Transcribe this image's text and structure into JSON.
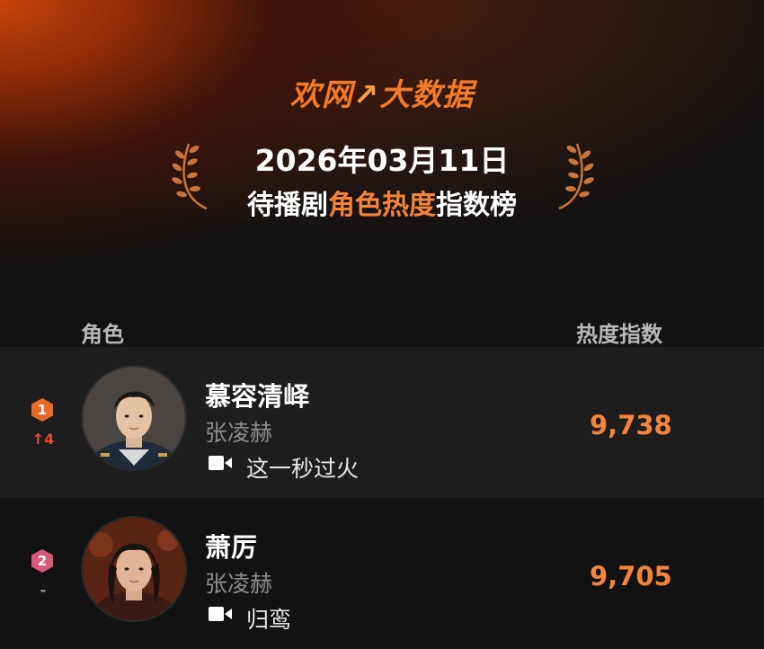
{
  "header": {
    "brand_part1": "欢网",
    "brand_slash": "↗",
    "brand_part2": "大数据",
    "date": "2026年03月11日",
    "title_prefix": "待播剧",
    "title_highlight": "角色热度",
    "title_suffix": "指数榜"
  },
  "columns": {
    "role": "角色",
    "heat": "热度指数"
  },
  "colors": {
    "accent": "#f4843a",
    "rank1": "#e8692a",
    "rank2": "#d95a7a",
    "up": "#e8473c"
  },
  "rows": [
    {
      "rank": "1",
      "change": "↑4",
      "character": "慕容清峄",
      "actor": "张凌赫",
      "drama_icon": "video-camera-icon",
      "drama": "这一秒过火",
      "score": "9,738"
    },
    {
      "rank": "2",
      "change": "-",
      "character": "萧厉",
      "actor": "张凌赫",
      "drama_icon": "video-camera-icon",
      "drama": "归鸾",
      "score": "9,705"
    }
  ]
}
